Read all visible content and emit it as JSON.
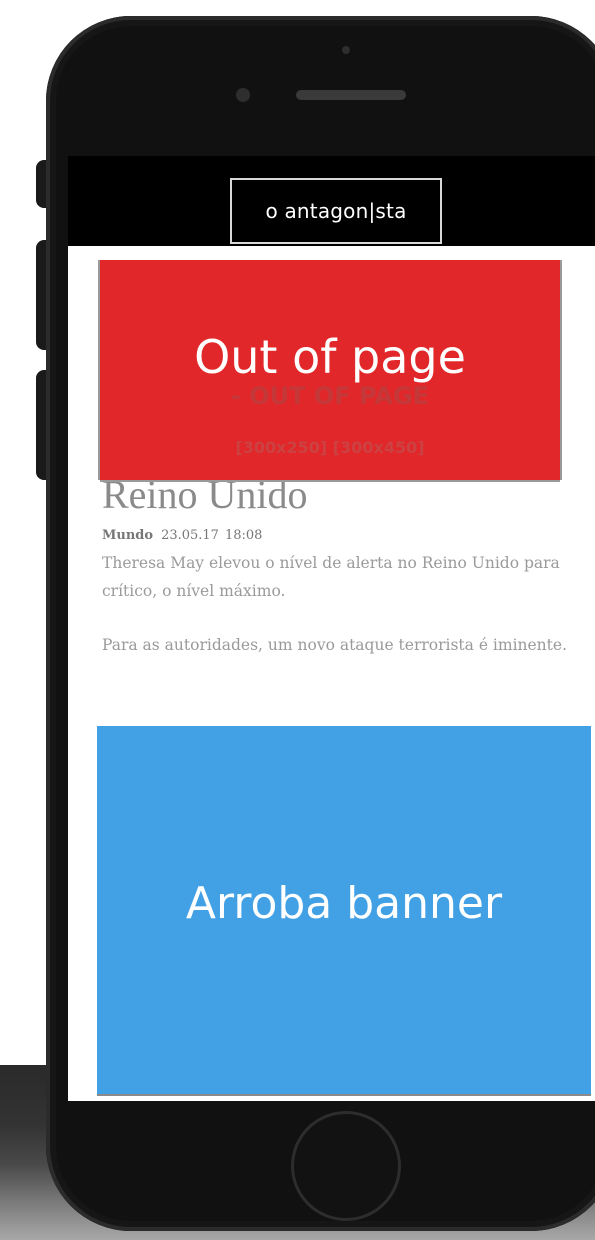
{
  "site": {
    "logo_text": "o antagon|sta"
  },
  "ad_out_of_page": {
    "label": "Out of page",
    "underlay_title": "- OUT OF PAGE",
    "underlay_sizes": "[300x250] [300x450]"
  },
  "article": {
    "headline": "Reino Unido",
    "section": "Mundo",
    "date": "23.05.17",
    "time": "18:08",
    "paragraphs": [
      "Theresa May elevou o nível de alerta no Reino Unido para crítico, o nível máximo.",
      "Para as autoridades, um novo ataque terrorista é iminente."
    ]
  },
  "ad_arroba": {
    "label": "Arroba banner"
  },
  "colors": {
    "out_of_page": "#e12729",
    "arroba": "#42a0e5",
    "header": "#000000"
  }
}
